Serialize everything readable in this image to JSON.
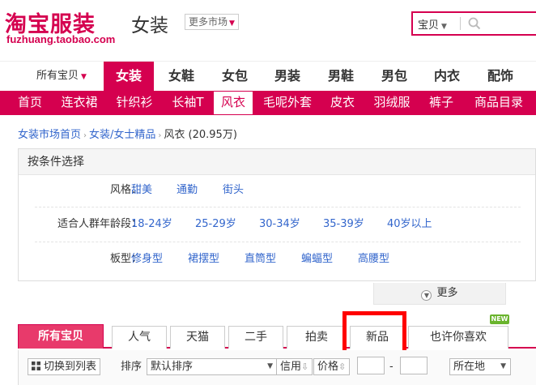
{
  "header": {
    "logo": "淘宝服装",
    "domain": "fuzhuang.taobao.com",
    "category": "女装",
    "more_market": "更多市场",
    "search_type": "宝贝"
  },
  "nav": {
    "all_items": "所有宝贝",
    "items": [
      "女装",
      "女鞋",
      "女包",
      "男装",
      "男鞋",
      "男包",
      "内衣",
      "配饰"
    ],
    "active": "女装"
  },
  "subnav": {
    "items": [
      "首页",
      "连衣裙",
      "针织衫",
      "长袖T",
      "风衣",
      "毛呢外套",
      "皮衣",
      "羽绒服",
      "裤子",
      "商品目录"
    ],
    "active": "风衣"
  },
  "breadcrumb": {
    "home": "女装市场首页",
    "parent": "女装/女士精品",
    "current": "风衣 (20.95万)"
  },
  "filter": {
    "title": "按条件选择",
    "rows": [
      {
        "label": "风格：",
        "options": [
          "甜美",
          "通勤",
          "街头"
        ]
      },
      {
        "label": "适合人群年龄段：",
        "options": [
          "18-24岁",
          "25-29岁",
          "30-34岁",
          "35-39岁",
          "40岁以上"
        ]
      },
      {
        "label": "板型：",
        "options": [
          "修身型",
          "裙摆型",
          "直筒型",
          "蝙蝠型",
          "高腰型"
        ]
      }
    ],
    "more": "更多"
  },
  "tabs": {
    "items": [
      "所有宝贝",
      "人气",
      "天猫",
      "二手",
      "拍卖",
      "新品",
      "也许你喜欢"
    ],
    "active": "所有宝贝",
    "badge": "NEW"
  },
  "toolbar": {
    "switch_list": "切换到列表",
    "sort_label": "排序",
    "sort_value": "默认排序",
    "credit": "信用",
    "price": "价格",
    "dash": "-",
    "location": "所在地"
  },
  "colors": {
    "brand": "#d5004f",
    "link": "#3366cc",
    "highlight": "#ff0000",
    "badge": "#6ab42d"
  }
}
